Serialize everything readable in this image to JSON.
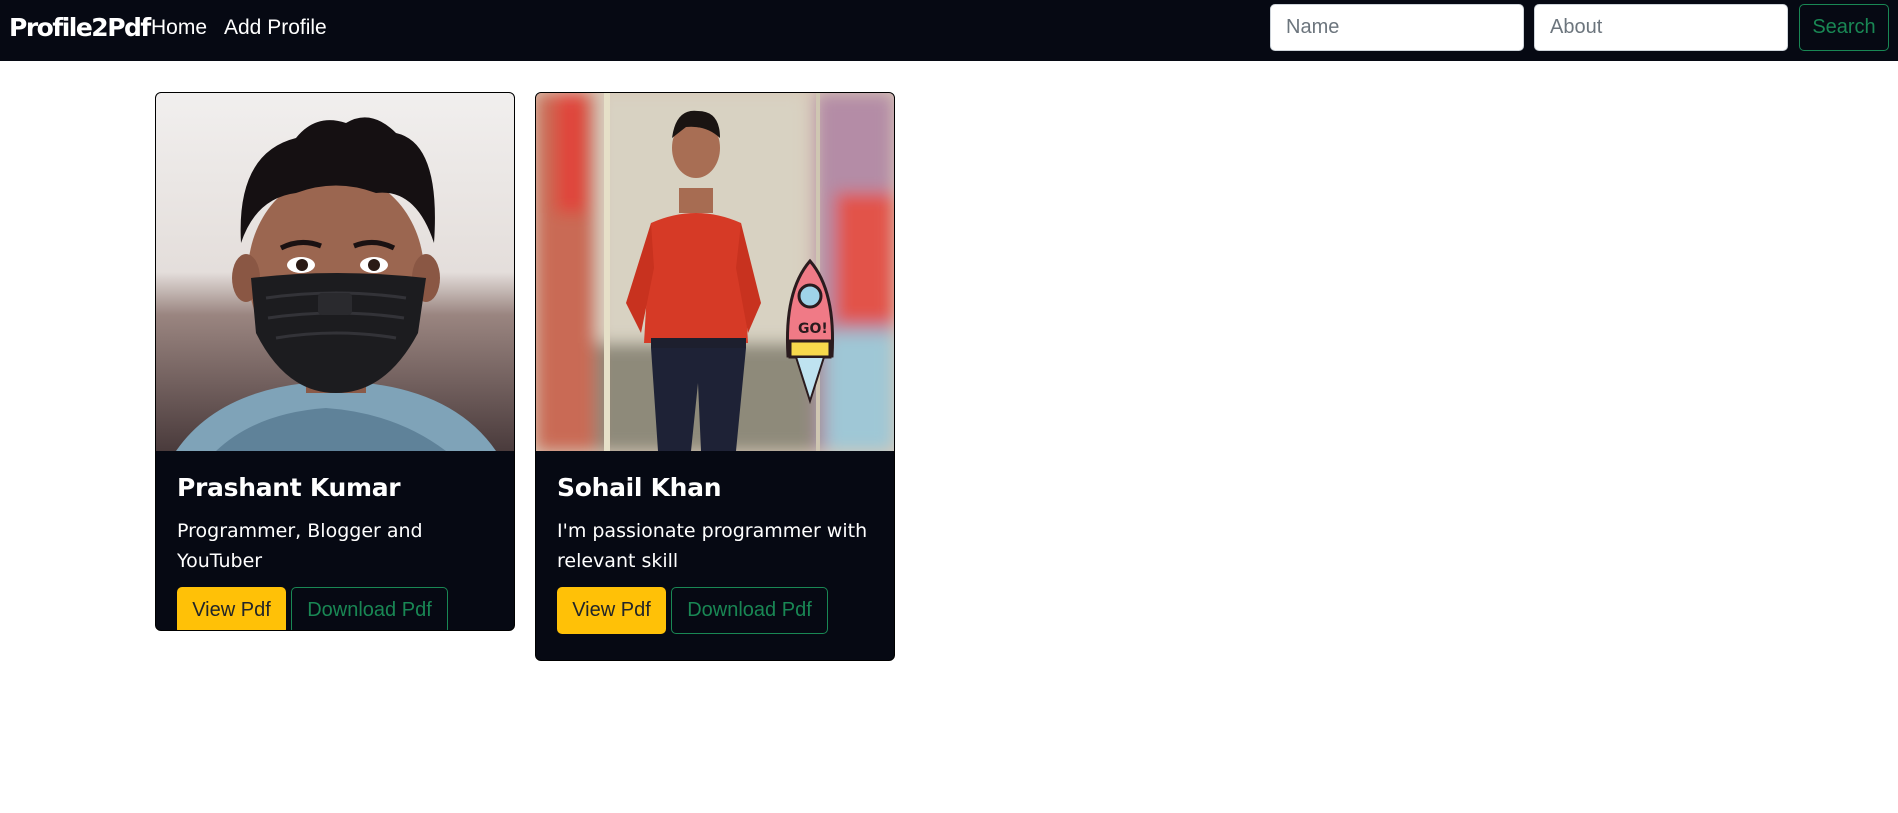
{
  "navbar": {
    "brand": "Profile2Pdf",
    "links": [
      {
        "label": "Home"
      },
      {
        "label": "Add Profile"
      }
    ],
    "search": {
      "name_placeholder": "Name",
      "about_placeholder": "About",
      "button_label": "Search"
    }
  },
  "profiles": [
    {
      "name": "Prashant Kumar",
      "about": "Programmer, Blogger and YouTuber",
      "view_label": "View Pdf",
      "download_label": "Download Pdf"
    },
    {
      "name": "Sohail Khan",
      "about": "I'm passionate programmer with relevant skill",
      "view_label": "View Pdf",
      "download_label": "Download Pdf"
    }
  ],
  "colors": {
    "navbar_bg": "#060913",
    "view_button": "#ffc107",
    "outline_success": "#198754"
  }
}
